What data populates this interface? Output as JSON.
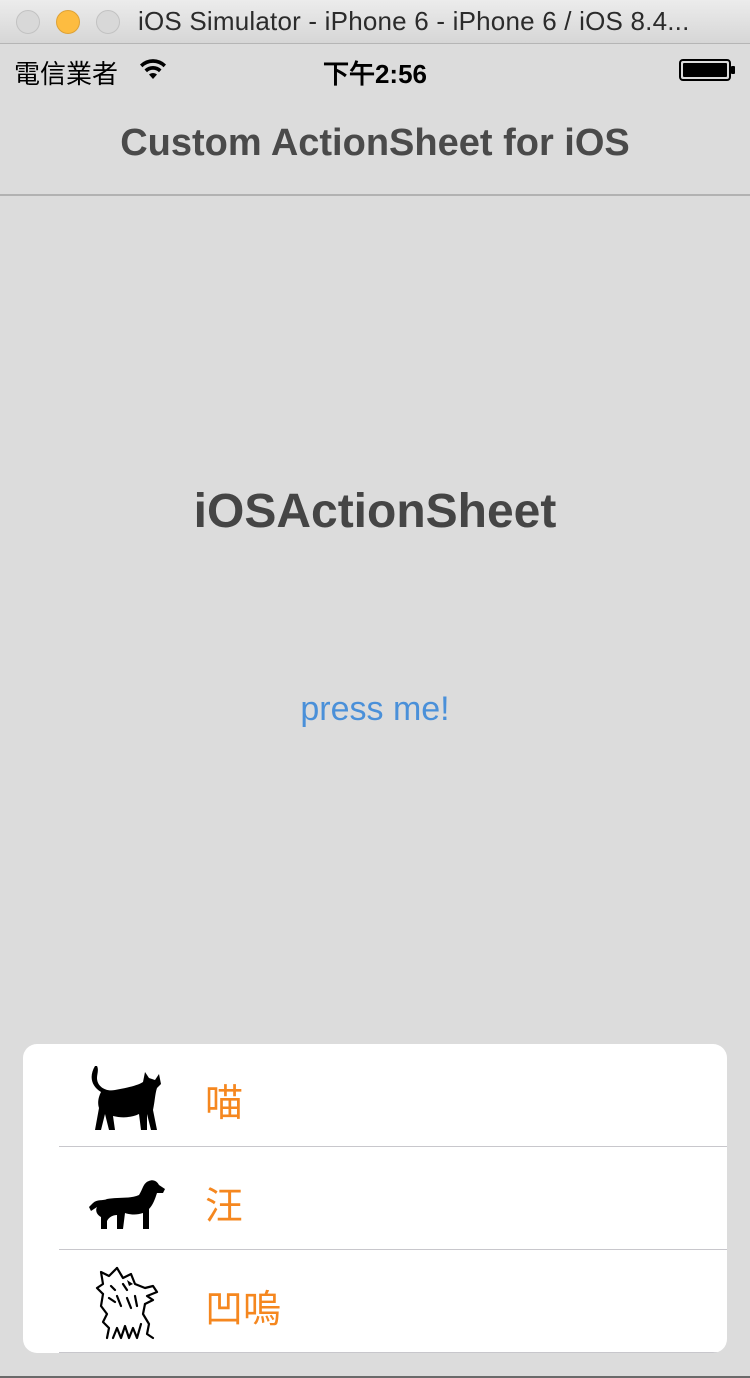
{
  "window": {
    "title": "iOS Simulator - iPhone 6 - iPhone 6 / iOS 8.4..."
  },
  "status_bar": {
    "carrier": "電信業者",
    "time": "下午2:56"
  },
  "nav": {
    "title": "Custom ActionSheet for iOS"
  },
  "main": {
    "label": "iOSActionSheet",
    "button_label": "press me!"
  },
  "action_sheet": {
    "items": [
      {
        "icon": "cat-icon",
        "label": "喵"
      },
      {
        "icon": "dog-icon",
        "label": "汪"
      },
      {
        "icon": "wolf-icon",
        "label": "凹嗚"
      }
    ]
  },
  "colors": {
    "accent_blue": "#4a90d9",
    "item_orange": "#f5871f",
    "background": "#dcdcdc"
  }
}
